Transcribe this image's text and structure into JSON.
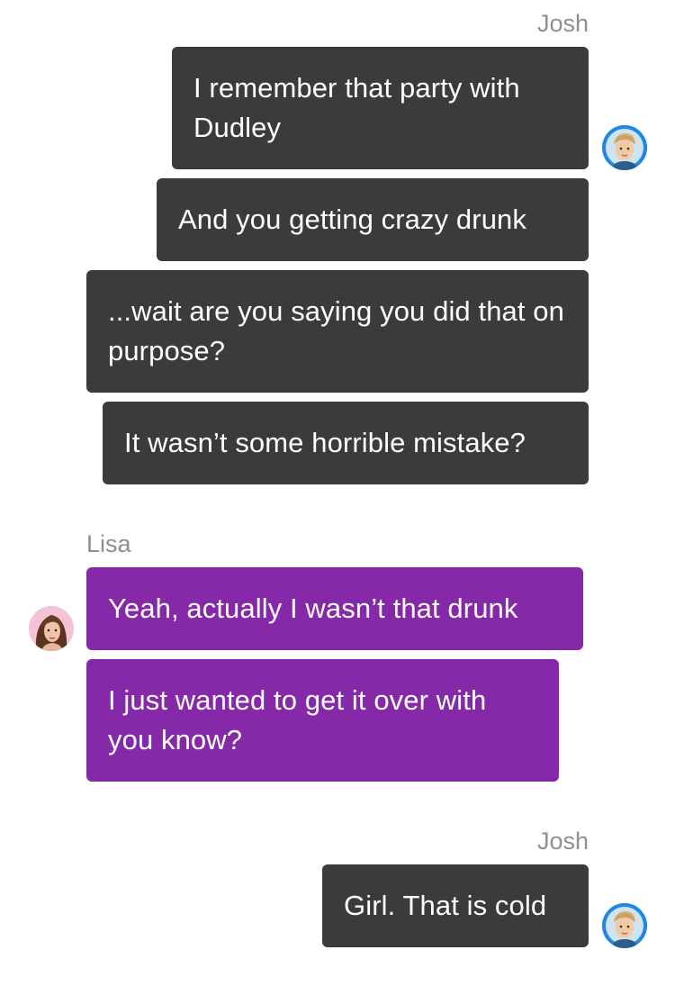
{
  "conversation": {
    "groups": [
      {
        "sender": "Josh",
        "messages": [
          "I remember that party with Dudley",
          "And you getting crazy drunk",
          "...wait are you saying you did that on purpose?",
          "It wasn’t some horrible mistake?"
        ]
      },
      {
        "sender": "Lisa",
        "messages": [
          "Yeah, actually I wasn’t that drunk",
          "I just wanted to get it over with you know?"
        ]
      },
      {
        "sender": "Josh",
        "messages": [
          "Girl. That is cold"
        ]
      }
    ]
  },
  "colors": {
    "josh_bubble": "#3b3b3b",
    "lisa_bubble": "#8629a8",
    "sender_name": "#8e8e93",
    "josh_avatar_ring": "#1e88e5",
    "background": "#ffffff"
  },
  "icons": {
    "josh_avatar": "avatar-josh-icon",
    "lisa_avatar": "avatar-lisa-icon"
  }
}
